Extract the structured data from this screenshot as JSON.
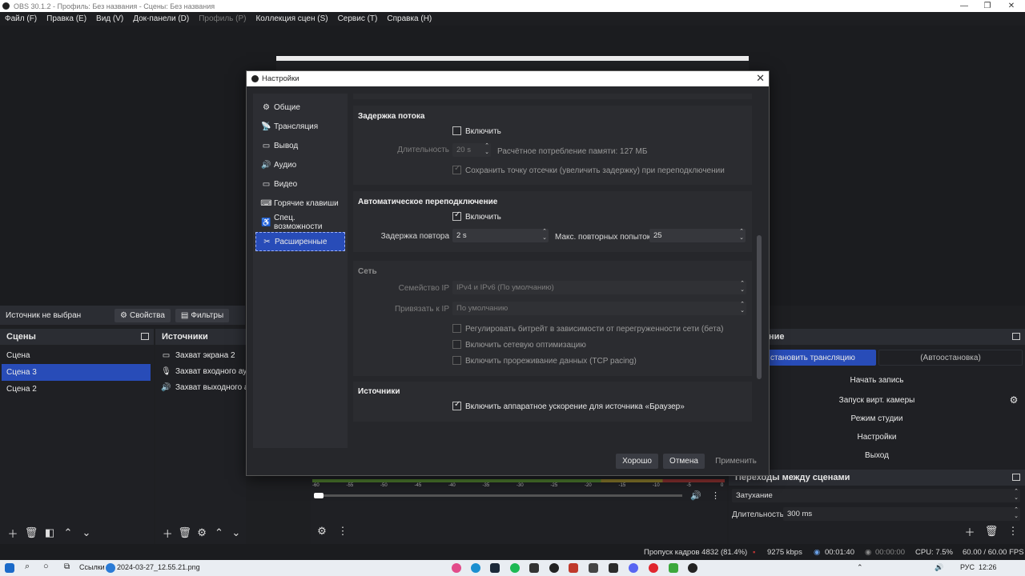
{
  "window": {
    "title": "OBS 30.1.2 - Профиль: Без названия - Сцены: Без названия",
    "minimize": "—",
    "maximize": "❐",
    "close": "✕"
  },
  "menu": [
    {
      "label": "Файл (F)",
      "disabled": false
    },
    {
      "label": "Правка (E)",
      "disabled": false
    },
    {
      "label": "Вид (V)",
      "disabled": false
    },
    {
      "label": "Док-панели (D)",
      "disabled": false
    },
    {
      "label": "Профиль (P)",
      "disabled": true
    },
    {
      "label": "Коллекция сцен (S)",
      "disabled": false
    },
    {
      "label": "Сервис (T)",
      "disabled": false
    },
    {
      "label": "Справка (H)",
      "disabled": false
    }
  ],
  "sourcebar": {
    "no_source": "Источник не выбран",
    "properties": "Свойства",
    "filters": "Фильтры"
  },
  "scenes": {
    "title": "Сцены",
    "items": [
      "Сцена",
      "Сцена 3",
      "Сцена 2"
    ],
    "selected_index": 1
  },
  "sources": {
    "title": "Источники",
    "items": [
      {
        "label": "Захват экрана 2",
        "icon": "monitor-icon"
      },
      {
        "label": "Захват входного аудио",
        "icon": "microphone-icon"
      },
      {
        "label": "Захват выходного аудио",
        "icon": "speaker-icon"
      }
    ]
  },
  "mixer": {
    "ticks": [
      "-60",
      "-55",
      "-50",
      "-45",
      "-40",
      "-35",
      "-30",
      "-25",
      "-20",
      "-15",
      "-10",
      "-5",
      "0"
    ]
  },
  "controls": {
    "title_fragment": "ние",
    "stop_stream": "становить трансляцию",
    "autostop": "(Автоостановка)",
    "start_record": "Начать запись",
    "virtual_camera": "Запуск вирт. камеры",
    "studio_mode": "Режим студии",
    "settings": "Настройки",
    "exit": "Выход"
  },
  "transitions": {
    "title": "Переходы между сценами",
    "selected": "Затухание",
    "duration_label": "Длительность",
    "duration_value": "300 ms"
  },
  "status": {
    "dropped": "Пропуск кадров 4832 (81.4%)",
    "bitrate": "9275 kbps",
    "stream_time": "00:01:40",
    "record_time": "00:00:00",
    "cpu": "CPU: 7.5%",
    "fps": "60.00 / 60.00 FPS"
  },
  "taskbar": {
    "links": "Ссылки",
    "file": "2024-03-27_12.55.21.png",
    "lang": "РУС",
    "time": "12:26"
  },
  "dialog": {
    "title": "Настройки",
    "nav": [
      {
        "label": "Общие",
        "icon": "gear-icon"
      },
      {
        "label": "Трансляция",
        "icon": "antenna-icon"
      },
      {
        "label": "Вывод",
        "icon": "output-icon"
      },
      {
        "label": "Аудио",
        "icon": "speaker-icon"
      },
      {
        "label": "Видео",
        "icon": "monitor-icon"
      },
      {
        "label": "Горячие клавиши",
        "icon": "keyboard-icon"
      },
      {
        "label": "Спец. возможности",
        "icon": "accessibility-icon"
      },
      {
        "label": "Расширенные",
        "icon": "tools-icon"
      }
    ],
    "active_nav": 7,
    "stream_delay": {
      "title": "Задержка потока",
      "enable": "Включить",
      "enabled": false,
      "duration_label": "Длительность",
      "duration_value": "20 s",
      "memory": "Расчётное потребление памяти: 127 МБ",
      "preserve": "Сохранить точку отсечки (увеличить задержку) при переподключении",
      "preserve_checked": true
    },
    "reconnect": {
      "title": "Автоматическое переподключение",
      "enable": "Включить",
      "enabled": true,
      "retry_delay_label": "Задержка повтора",
      "retry_delay_value": "2 s",
      "max_retries_label": "Макс. повторных попыток",
      "max_retries_value": "25"
    },
    "network": {
      "title": "Сеть",
      "ip_family_label": "Семейство IP",
      "ip_family_value": "IPv4 и IPv6 (По умолчанию)",
      "bind_label": "Привязать к IP",
      "bind_value": "По умолчанию",
      "dynamic_bitrate": "Регулировать битрейт в зависимости от перегруженности сети (бета)",
      "optimizations": "Включить сетевую оптимизацию",
      "tcp_pacing": "Включить прореживание данных (TCP pacing)"
    },
    "sources": {
      "title": "Источники",
      "browser_hw": "Включить аппаратное ускорение для источника «Браузер»",
      "browser_hw_checked": true
    },
    "buttons": {
      "ok": "Хорошо",
      "cancel": "Отмена",
      "apply": "Применить"
    }
  }
}
